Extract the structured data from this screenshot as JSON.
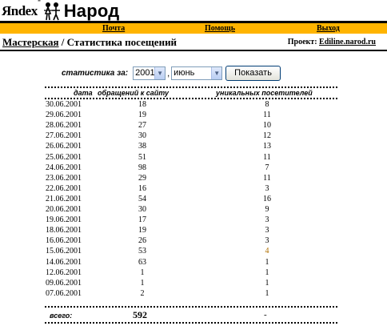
{
  "logo": {
    "yandex": "Яndex",
    "reg": "®",
    "narod": "Народ"
  },
  "nav": {
    "mail": "Почта",
    "help": "Помощь",
    "logout": "Выход"
  },
  "breadcrumb": {
    "workshop": "Мастерская",
    "separator": "/",
    "title": "Статистика посещений"
  },
  "project": {
    "label": "Проект:",
    "site": "Ediline.narod.ru"
  },
  "filter": {
    "label": "статистика за:",
    "year": "2001",
    "month": "июнь",
    "comma": ",",
    "show_button": "Показать"
  },
  "table": {
    "headers": [
      "дата",
      "обращений к сайту",
      "уникальных посетителей"
    ],
    "rows": [
      [
        "30.06.2001",
        "18",
        "8"
      ],
      [
        "29.06.2001",
        "19",
        "11"
      ],
      [
        "28.06.2001",
        "27",
        "10"
      ],
      [
        "27.06.2001",
        "30",
        "12"
      ],
      [
        "26.06.2001",
        "38",
        "13"
      ],
      [
        "25.06.2001",
        "51",
        "11"
      ],
      [
        "24.06.2001",
        "98",
        "7"
      ],
      [
        "23.06.2001",
        "29",
        "11"
      ],
      [
        "22.06.2001",
        "16",
        "3"
      ],
      [
        "21.06.2001",
        "54",
        "16"
      ],
      [
        "20.06.2001",
        "30",
        "9"
      ],
      [
        "19.06.2001",
        "17",
        "3"
      ],
      [
        "18.06.2001",
        "19",
        "3"
      ],
      [
        "16.06.2001",
        "26",
        "3"
      ],
      [
        "15.06.2001",
        "53",
        "4"
      ],
      [
        "14.06.2001",
        "63",
        "1"
      ],
      [
        "12.06.2001",
        "1",
        "1"
      ],
      [
        "09.06.2001",
        "1",
        "1"
      ],
      [
        "07.06.2001",
        "2",
        "1"
      ]
    ],
    "total_label": "всего:",
    "total_hits": "592",
    "total_unique": "-"
  },
  "colors": {
    "nav_bar": "#ffb400",
    "unique_highlight": "#b07000"
  }
}
